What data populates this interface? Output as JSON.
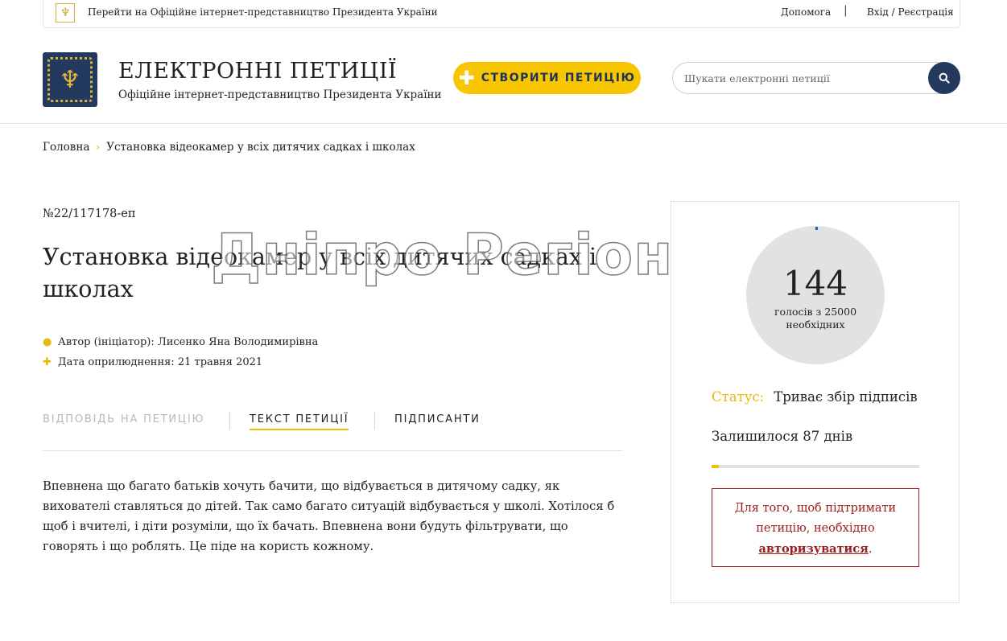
{
  "topbar": {
    "link_label": "Перейти на Офіційне інтернет-представництво Президента України",
    "help_label": "Допомога",
    "separator": "|",
    "login_label": "Вхід / Реєстрація"
  },
  "header": {
    "title": "ЕЛЕКТРОННІ ПЕТИЦІЇ",
    "subtitle": "Офіційне інтернет-представництво Президента України",
    "create_label": "СТВОРИТИ ПЕТИЦІЮ",
    "create_icon": "plus-icon",
    "search_placeholder": "Шукати електронні петиції",
    "search_icon": "search-icon",
    "logo_icon": "trident-icon",
    "brand_color": "#233a5e",
    "accent_color": "#f7c600"
  },
  "breadcrumb": {
    "home": "Головна",
    "current": "Установка відеокамер у всіх дитячих садках і школах"
  },
  "petition": {
    "number": "№22/117178-еп",
    "title": "Установка відеокамер у всіх дитячих садках і школах",
    "author": "Автор (ініціатор): Лисенко Яна Володимирівна",
    "date": "Дата оприлюднення: 21 травня 2021",
    "author_icon": "user-icon",
    "date_icon": "plus-icon",
    "tabs": [
      {
        "label": "ВІДПОВІДЬ НА ПЕТИЦІЮ",
        "state": "disabled"
      },
      {
        "label": "ТЕКСТ ПЕТИЦІЇ",
        "state": "active"
      },
      {
        "label": "ПІДПИСАНТИ",
        "state": "normal"
      }
    ],
    "text": "Впевнена що багато батьків хочуть бачити, що відбувається в дитячому садку, як вихователі ставляться до дітей. Так само багато ситуацій відбувається у школі. Хотілося б щоб і вчителі, і діти розуміли, що їх бачать. Впевнена вони будуть фільтрувати, що говорять і що роблять. Це піде на користь кожному."
  },
  "watermark": "Дніпро Регіон",
  "sidebar": {
    "votes": "144",
    "votes_of": "голосів з 25000",
    "votes_needed": "необхідних",
    "progress_fraction": 0.00576,
    "status_label": "Статус:",
    "status_value": "Триває збір підписів",
    "remaining": "Залишилося 87 днів",
    "auth_text": "Для того, щоб підтримати петицію, необхідно",
    "auth_link": "авторизуватися",
    "auth_end": ".",
    "gauge_color": "#1f5fa8",
    "alert_color": "#9c1d1d"
  }
}
